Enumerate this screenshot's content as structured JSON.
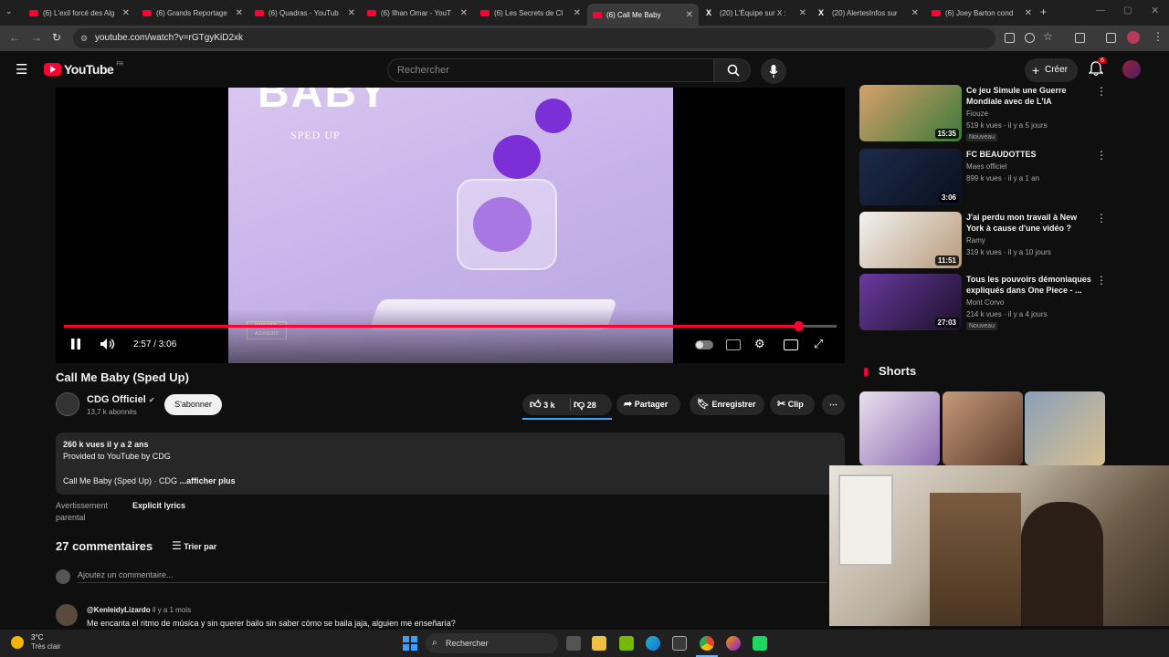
{
  "browser": {
    "tabs": [
      {
        "label": "(6) L'exil forcé des Alg",
        "icon": "youtube-icon"
      },
      {
        "label": "(6) Grands Reportage",
        "icon": "youtube-icon"
      },
      {
        "label": "(6) Quadras - YouTub",
        "icon": "youtube-icon"
      },
      {
        "label": "(6) Ilhan Omar - YouT",
        "icon": "youtube-icon"
      },
      {
        "label": "(6) Les Secrets de Cl",
        "icon": "youtube-icon"
      },
      {
        "label": "(6) Call Me Baby",
        "icon": "youtube-icon",
        "active": true
      },
      {
        "label": "(20) L'Équipe sur X :",
        "icon": "x-icon"
      },
      {
        "label": "(20) AlertesInfos sur",
        "icon": "x-icon"
      },
      {
        "label": "(6) Joey Barton cond",
        "icon": "youtube-icon"
      }
    ],
    "url": "youtube.com/watch?v=rGTgyKiD2xk"
  },
  "header": {
    "logo": "YouTube",
    "region": "FR",
    "search_placeholder": "Rechercher",
    "create_label": "Créer",
    "notif_count": "6"
  },
  "player": {
    "cover_text_top": "BABY",
    "cover_text_sub": "SPED UP",
    "time": "2:57 / 3:06",
    "progress": 0.95,
    "accent": "#ff0033"
  },
  "video": {
    "title": "Call Me Baby (Sped Up)",
    "channel": "CDG Officiel",
    "subscribers": "13,7 k abonnés",
    "subscribe_label": "S'abonner",
    "likes": "3 k",
    "dislikes": "28",
    "share_label": "Partager",
    "save_label": "Enregistrer",
    "clip_label": "Clip"
  },
  "description": {
    "stats": "260 k vues  il y a 2 ans",
    "line1": "Provided to YouTube by CDG",
    "line2": "Call Me Baby (Sped Up) · CDG",
    "more": "...afficher plus"
  },
  "advisory": {
    "label_line1": "Avertissement",
    "label_line2": "parental",
    "value": "Explicit lyrics"
  },
  "comments": {
    "count": "27 commentaires",
    "sort_label": "Trier par",
    "add_placeholder": "Ajoutez un commentaire...",
    "first": {
      "author": "@KenleidyLizardo",
      "time": "il y a 1 mois",
      "text": "Me encanta el ritmo de música y sin querer bailo sin saber cómo se baila jaja, alguien me enseñaría?"
    }
  },
  "sidebar": {
    "videos": [
      {
        "title": "Ce jeu Simule une Guerre Mondiale avec de L'IA",
        "channel": "Fiouze",
        "meta": "519 k vues · il y a 5 jours",
        "duration": "15:35",
        "badge": "Nouveau"
      },
      {
        "title": "FC BEAUDOTTES",
        "channel": "Maes officiel",
        "meta": "899 k vues · il y a 1 an",
        "duration": "3:06",
        "badge": ""
      },
      {
        "title": "J'ai perdu mon travail à New York à cause d'une vidéo ?",
        "channel": "Ramy",
        "meta": "319 k vues · il y a 10 jours",
        "duration": "11:51",
        "badge": ""
      },
      {
        "title": "Tous les pouvoirs démoniaques expliqués dans One Piece - ...",
        "channel": "Mont Corvo",
        "meta": "214 k vues · il y a 4 jours",
        "duration": "27:03",
        "badge": "Nouveau"
      }
    ],
    "shorts_label": "Shorts"
  },
  "taskbar": {
    "temp": "3°C",
    "weather": "Très clair",
    "search_label": "Rechercher"
  }
}
